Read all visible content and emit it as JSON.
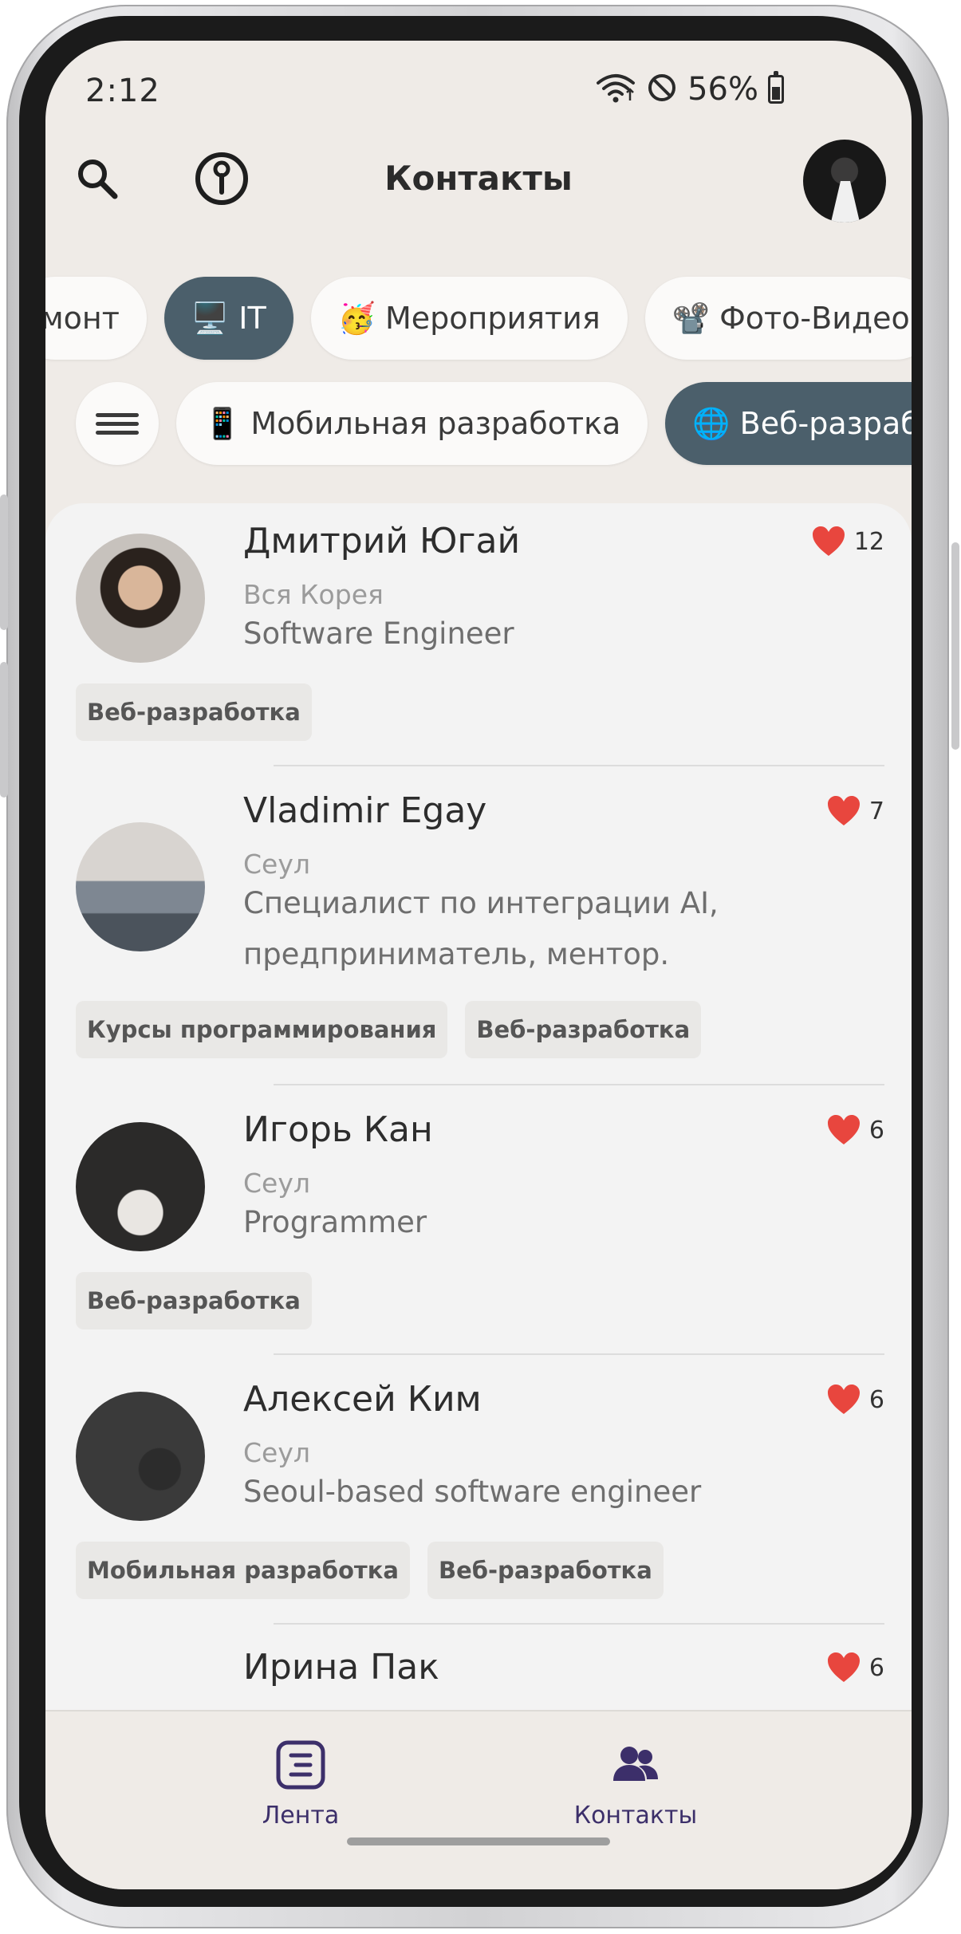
{
  "status_bar": {
    "time": "2:12",
    "battery": "56%",
    "battery_level": 0.56
  },
  "header": {
    "title": "Контакты"
  },
  "categories": [
    {
      "label": "монт",
      "emoji": "",
      "active": false
    },
    {
      "label": "IT",
      "emoji": "🖥️",
      "active": true
    },
    {
      "label": "Мероприятия",
      "emoji": "🥳",
      "active": false
    },
    {
      "label": "Фото-Видео",
      "emoji": "📽️",
      "active": false
    }
  ],
  "subcategories": [
    {
      "label": "Мобильная разработка",
      "emoji": "📱",
      "active": false
    },
    {
      "label": "Веб-разработка",
      "emoji": "🌐",
      "active": true
    }
  ],
  "contacts": [
    {
      "name": "Дмитрий Югай",
      "city": "Вся Корея",
      "description": "Software Engineer",
      "likes": "12",
      "tags": [
        "Веб-разработка"
      ]
    },
    {
      "name": "Vladimir Egay",
      "city": "Сеул",
      "description": "Специалист по интеграции AI, предприниматель, ментор.",
      "likes": "7",
      "tags": [
        "Курсы программирования",
        "Веб-разработка"
      ]
    },
    {
      "name": "Игорь Кан",
      "city": "Сеул",
      "description": "Programmer",
      "likes": "6",
      "tags": [
        "Веб-разработка"
      ]
    },
    {
      "name": "Алексей Ким",
      "city": "Сеул",
      "description": "Seoul-based software engineer",
      "likes": "6",
      "tags": [
        "Мобильная разработка",
        "Веб-разработка"
      ]
    },
    {
      "name": "Ирина Пак",
      "city": "",
      "description": "",
      "likes": "6",
      "tags": []
    }
  ],
  "bottom_nav": [
    {
      "label": "Лента",
      "icon": "feed-icon"
    },
    {
      "label": "Контакты",
      "icon": "contacts-icon"
    }
  ],
  "colors": {
    "active_chip": "#4b5f6b",
    "like": "#e8463e",
    "nav_accent": "#3c2f6a",
    "background": "#efebe7"
  }
}
